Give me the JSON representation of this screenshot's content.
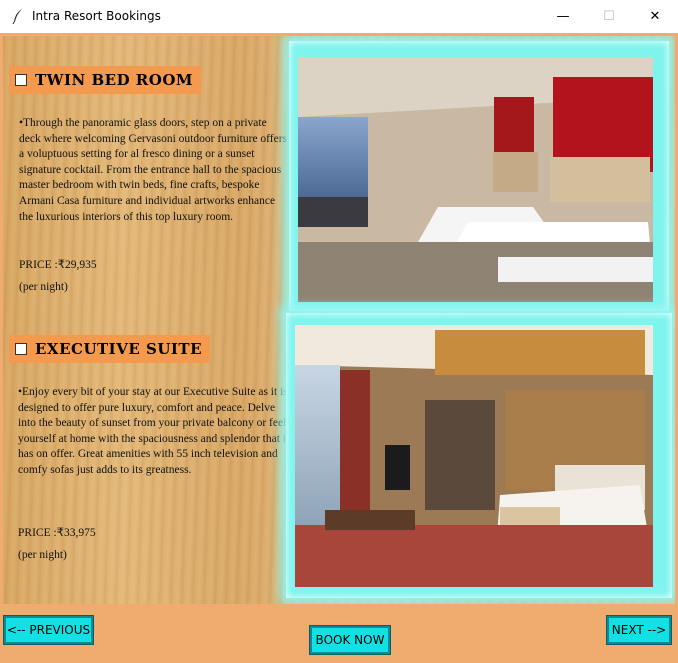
{
  "window": {
    "title": "Intra Resort Bookings",
    "minimize_symbol": "—",
    "maximize_symbol": "☐",
    "close_symbol": "✕"
  },
  "rooms": [
    {
      "name": "TWIN BED ROOM",
      "checked": false,
      "description": "•Through the panoramic glass doors, step on a private deck where welcoming Gervasoni outdoor furniture offers a voluptuous setting for al fresco dining or a sunset signature cocktail. From the entrance hall to the spacious master bedroom with twin beds, fine crafts, bespoke Armani Casa furniture and individual artworks enhance the luxurious interiors of this top luxury room.",
      "price": "PRICE :₹29,935",
      "per_night": "(per night)"
    },
    {
      "name": "EXECUTIVE SUITE",
      "checked": false,
      "description": "•Enjoy every bit of your stay at our Executive Suite as it is designed to offer pure luxury, comfort and peace. Delve into the beauty of sunset from your private balcony or feel yourself at home with the spaciousness and splendor that it has on offer. Great amenities with 55 inch television and comfy sofas just adds to its greatness.",
      "price": "PRICE :₹33,975",
      "per_night": "(per night)"
    }
  ],
  "buttons": {
    "previous": "<-- PREVIOUS",
    "book_now": "BOOK NOW",
    "next": "NEXT -->"
  },
  "colors": {
    "orange": "#f0ac6e",
    "heading_bg": "#f39a4f",
    "button_bg": "#11e0e4",
    "glow": "#7ff4ee"
  }
}
